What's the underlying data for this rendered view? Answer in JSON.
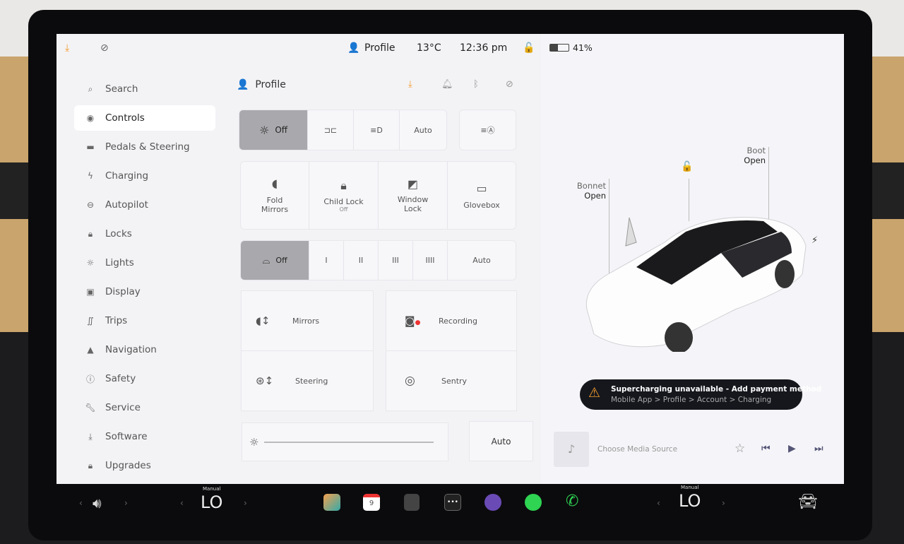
{
  "status": {
    "profile": "Profile",
    "temperature": "13°C",
    "time": "12:36 pm",
    "battery": "41%",
    "battery_level": 0.41
  },
  "sidebar": {
    "search": "Search",
    "items": [
      {
        "label": "Controls",
        "icon": "toggle-icon"
      },
      {
        "label": "Pedals & Steering",
        "icon": "car-icon"
      },
      {
        "label": "Charging",
        "icon": "bolt-icon"
      },
      {
        "label": "Autopilot",
        "icon": "steering-wheel-icon"
      },
      {
        "label": "Locks",
        "icon": "lock-icon"
      },
      {
        "label": "Lights",
        "icon": "sun-icon"
      },
      {
        "label": "Display",
        "icon": "display-icon"
      },
      {
        "label": "Trips",
        "icon": "trips-icon"
      },
      {
        "label": "Navigation",
        "icon": "navigation-icon"
      },
      {
        "label": "Safety",
        "icon": "safety-icon"
      },
      {
        "label": "Service",
        "icon": "wrench-icon"
      },
      {
        "label": "Software",
        "icon": "download-icon"
      },
      {
        "label": "Upgrades",
        "icon": "bag-icon"
      }
    ]
  },
  "panel": {
    "profile": "Profile",
    "lights": [
      "Off",
      "Auto"
    ],
    "tiles": {
      "fold": "Fold Mirrors",
      "child": "Child Lock",
      "child_state": "Off",
      "window": "Window Lock",
      "glovebox": "Glovebox"
    },
    "wipers": [
      "Off",
      "I",
      "II",
      "III",
      "IIII",
      "Auto"
    ],
    "mirrors": "Mirrors",
    "recording": "Recording",
    "steering": "Steering",
    "sentry": "Sentry",
    "brightness_auto": "Auto"
  },
  "car": {
    "bonnet": "Bonnet",
    "bonnet_state": "Open",
    "boot": "Boot",
    "boot_state": "Open"
  },
  "alert": {
    "title": "Supercharging unavailable - Add payment method",
    "path": "Mobile App > Profile > Account > Charging",
    "color": "#f39a2c"
  },
  "media": {
    "source": "Choose Media Source"
  },
  "dock": {
    "left_temp": "LO",
    "left_mode": "Manual",
    "right_temp": "LO",
    "right_mode": "Manual"
  }
}
